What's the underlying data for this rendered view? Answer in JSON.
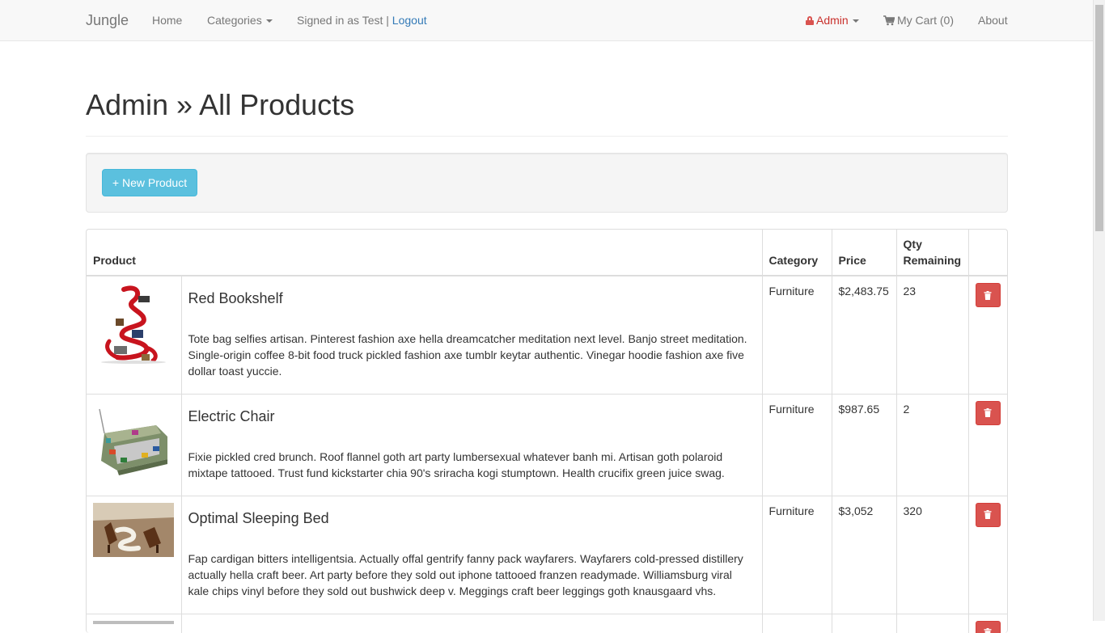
{
  "navbar": {
    "brand": "Jungle",
    "home": "Home",
    "categories": "Categories",
    "signed_in_text": "Signed in as Test |",
    "logout": "Logout",
    "admin": "Admin",
    "cart": "My Cart (0)",
    "about": "About"
  },
  "page": {
    "title": "Admin » All Products",
    "new_product_button": "+ New Product"
  },
  "table": {
    "headers": {
      "product": "Product",
      "category": "Category",
      "price": "Price",
      "qty": "Qty Remaining"
    },
    "rows": [
      {
        "name": "Red Bookshelf",
        "description": "Tote bag selfies artisan. Pinterest fashion axe hella dreamcatcher meditation next level. Banjo street meditation. Single-origin coffee 8-bit food truck pickled fashion axe tumblr keytar authentic. Vinegar hoodie fashion axe five dollar toast yuccie.",
        "category": "Furniture",
        "price": "$2,483.75",
        "qty": "23"
      },
      {
        "name": "Electric Chair",
        "description": "Fixie pickled cred brunch. Roof flannel goth art party lumbersexual whatever banh mi. Artisan goth polaroid mixtape tattooed. Trust fund kickstarter chia 90's sriracha kogi stumptown. Health crucifix green juice swag.",
        "category": "Furniture",
        "price": "$987.65",
        "qty": "2"
      },
      {
        "name": "Optimal Sleeping Bed",
        "description": "Fap cardigan bitters intelligentsia. Actually offal gentrify fanny pack wayfarers. Wayfarers cold-pressed distillery actually hella craft beer. Art party before they sold out iphone tattooed franzen readymade. Williamsburg viral kale chips vinyl before they sold out bushwick deep v. Meggings craft beer leggings goth knausgaard vhs.",
        "category": "Furniture",
        "price": "$3,052",
        "qty": "320"
      },
      {
        "name": "",
        "description": "",
        "category": "",
        "price": "",
        "qty": ""
      }
    ]
  },
  "colors": {
    "accent_info": "#5bc0de",
    "danger": "#d9534f",
    "link": "#337ab7"
  },
  "icons": [
    "lock-icon",
    "cart-icon",
    "trash-icon",
    "caret-down-icon"
  ]
}
